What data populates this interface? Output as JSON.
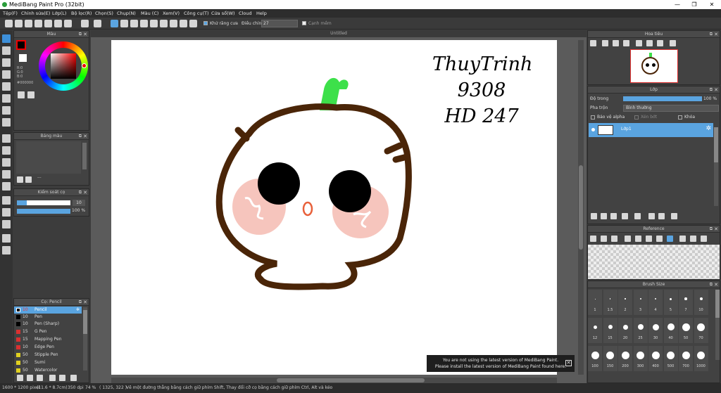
{
  "window": {
    "title": "MediBang Paint Pro (32bit)",
    "minimize": "—",
    "maximize": "❐",
    "close": "✕"
  },
  "menu": [
    "Tệp(F)",
    "Chỉnh sửa(E)",
    "Lớp(L)",
    "Bộ lọc(R)",
    "Chọn(S)",
    "Chụp(N)",
    "Màu (C)",
    "Xem(V)",
    "Công cụ(T)",
    "Cửa sổ(W)",
    "Cloud",
    "Help"
  ],
  "toolbar": {
    "antialias_label": "Khử răng cưa",
    "adjust_label": "Điều chỉnh",
    "adjust_value": "27",
    "edge_label": "Cạnh mềm"
  },
  "color_panel": {
    "title": "Màu",
    "r": "R:0",
    "g": "G:0",
    "b": "B:0",
    "hex": "#000000",
    "accent": "#ff0000"
  },
  "color_bar_panel": {
    "title": "Bảng màu"
  },
  "brush_control": {
    "title": "Kiểm soát cọ",
    "size": "10",
    "opacity": "100 %"
  },
  "brush_panel": {
    "title": "Cọ: Pencil",
    "items": [
      {
        "size": "10",
        "name": "Pencil",
        "color": "#000000"
      },
      {
        "size": "10",
        "name": "Pen",
        "color": "#000000"
      },
      {
        "size": "10",
        "name": "Pen (Sharp)",
        "color": "#000000"
      },
      {
        "size": "15",
        "name": "G Pen",
        "color": "#d93030"
      },
      {
        "size": "15",
        "name": "Mapping Pen",
        "color": "#d93030"
      },
      {
        "size": "10",
        "name": "Edge Pen",
        "color": "#d93030"
      },
      {
        "size": "50",
        "name": "Stipple Pen",
        "color": "#e0d020"
      },
      {
        "size": "50",
        "name": "Sumi",
        "color": "#e0d020"
      },
      {
        "size": "50",
        "name": "Watercolor",
        "color": "#e0d020"
      }
    ]
  },
  "canvas": {
    "tab": "Untitled",
    "handwriting": [
      "ThuyTrinh",
      "9308",
      "HD 247"
    ]
  },
  "navigator": {
    "title": "Hoa tiêu"
  },
  "layer_panel": {
    "title": "Lớp",
    "opacity_label": "Độ trong",
    "opacity_value": "100 %",
    "blend_label": "Pha trộn",
    "blend_value": "Bình thường",
    "protect_alpha": "Bảo vệ alpha",
    "clip": "Xén bớt",
    "lock": "Khóa",
    "layer_name": "Lớp1"
  },
  "reference": {
    "title": "Reference"
  },
  "brush_size": {
    "title": "Brush Size",
    "sizes": [
      "1",
      "1.5",
      "2",
      "3",
      "4",
      "5",
      "7",
      "10",
      "12",
      "15",
      "20",
      "25",
      "30",
      "40",
      "50",
      "70",
      "100",
      "150",
      "200",
      "300",
      "400",
      "500",
      "700",
      "1000"
    ]
  },
  "notification": {
    "line1": "You are not using the latest version of MediBang Paint.",
    "line2": "Please install the latest version of MediBang Paint found here.",
    "close": "✕"
  },
  "status": {
    "size": "1600 * 1200 pixel",
    "cm": "(11.6 * 8.7cm)",
    "dpi": "350 dpi",
    "zoom": "74 %",
    "coords": "( 1325, 322 )",
    "hint": "Vẽ một đường thẳng bằng cách giữ phím Shift, Thay đổi cỡ cọ bằng cách giữ phím Ctrl, Alt và kéo"
  }
}
